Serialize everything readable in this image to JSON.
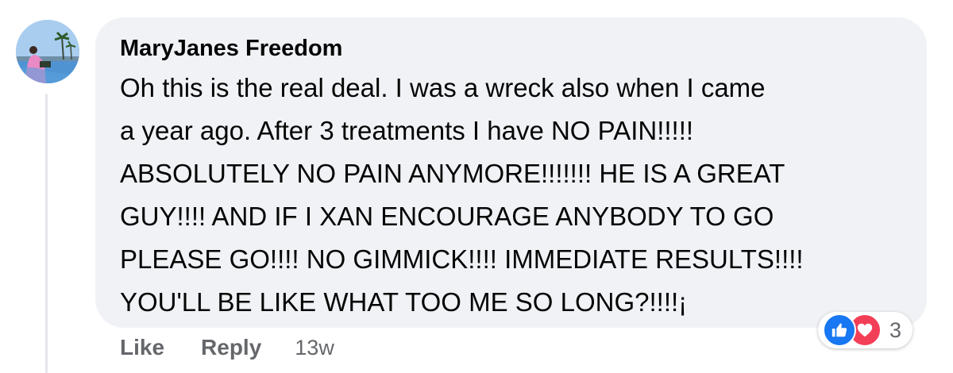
{
  "comment": {
    "author": "MaryJanes Freedom",
    "text_lines": [
      "Oh this is the real deal. I was a wreck also when I came",
      "a year ago. After 3 treatments I have NO PAIN!!!!!",
      "ABSOLUTELY NO PAIN ANYMORE!!!!!!! HE IS A GREAT",
      "GUY!!!! AND IF I XAN ENCOURAGE ANYBODY TO GO",
      "PLEASE GO!!!! NO GIMMICK!!!! IMMEDIATE RESULTS!!!!",
      "YOU'LL BE LIKE WHAT TOO ME SO LONG?!!!!¡"
    ]
  },
  "actions": {
    "like_label": "Like",
    "reply_label": "Reply",
    "timestamp": "13w"
  },
  "reactions": {
    "icons": [
      "like-icon",
      "love-icon"
    ],
    "count": "3",
    "like_color": "#1877f2",
    "love_color": "#f33e58"
  },
  "colors": {
    "bubble_bg": "#f0f2f5",
    "text": "#050505",
    "secondary_text": "#65676b"
  }
}
